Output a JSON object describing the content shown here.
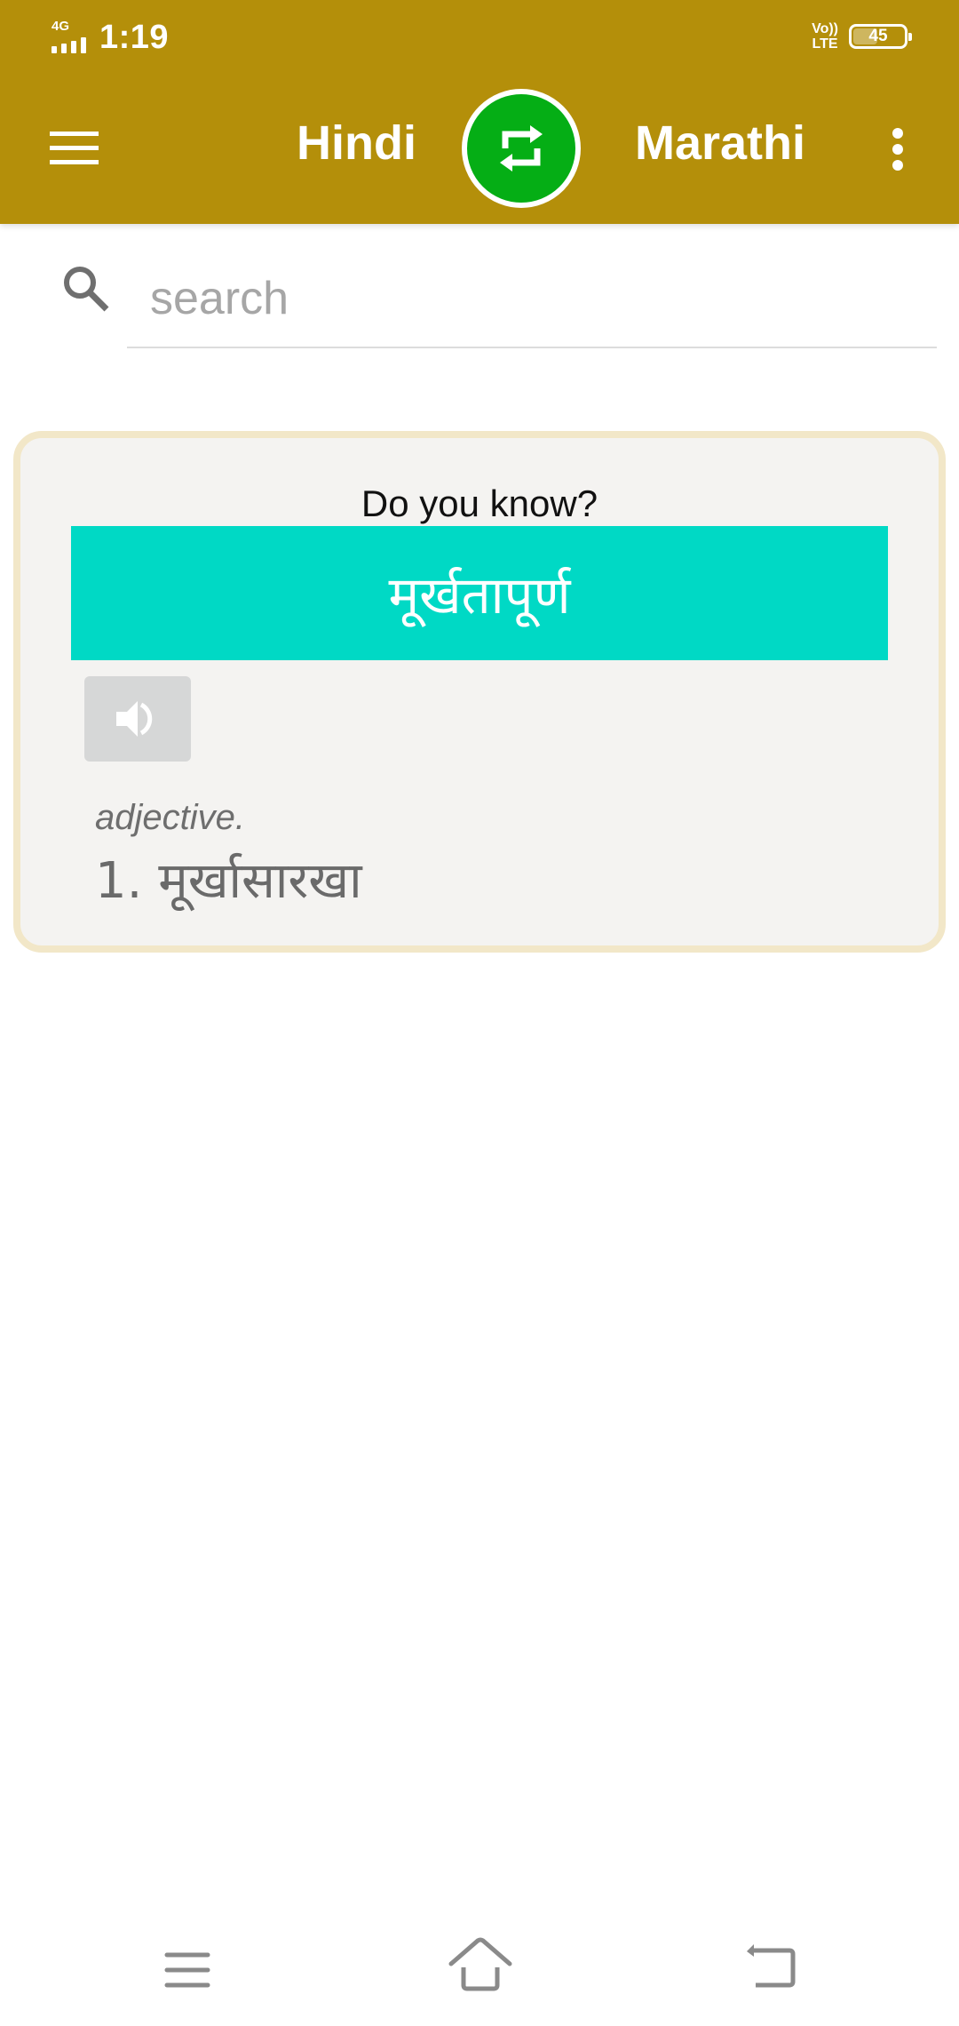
{
  "status_bar": {
    "network": "4G",
    "time": "1:19",
    "volte_top": "Vo))",
    "volte_bottom": "LTE",
    "battery_level": "45",
    "battery_fraction": 0.45
  },
  "app_bar": {
    "menu_icon": "hamburger-menu-icon",
    "source_language": "Hindi",
    "swap_icon": "swap-arrows-icon",
    "target_language": "Marathi",
    "more_icon": "more-vertical-icon"
  },
  "search": {
    "icon": "search-icon",
    "placeholder": "search",
    "value": ""
  },
  "word_of_day": {
    "title": "Do you know?",
    "word": "मूर्खतापूर्ण",
    "speak_icon": "speaker-icon",
    "part_of_speech": "adjective.",
    "meanings": [
      "1. मूर्खासारखा"
    ]
  },
  "colors": {
    "app_bar": "#B48F0A",
    "swap_button": "#05AE15",
    "word_band": "#00D9C5",
    "card_border": "#F2E7C8",
    "card_bg": "#F4F3F1"
  },
  "nav_bar": {
    "recents_icon": "recents-icon",
    "home_icon": "home-icon",
    "back_icon": "back-icon"
  }
}
